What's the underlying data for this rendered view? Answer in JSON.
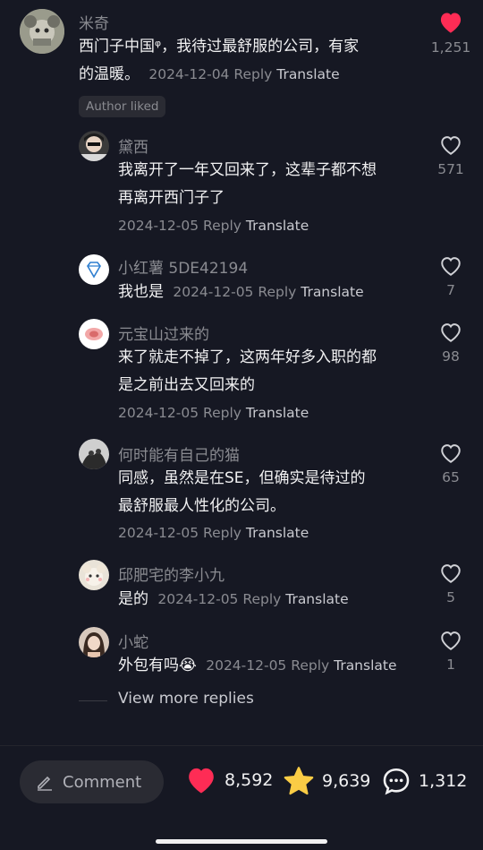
{
  "main_comment": {
    "username": "米奇",
    "text_line1": "西门子中国ᵠ，我待过最舒服的公司，有家",
    "text_line2": "的温暖。",
    "date": "2024-12-04",
    "reply": "Reply",
    "translate": "Translate",
    "likes": "1,251",
    "liked": true,
    "badge": "Author liked"
  },
  "replies": [
    {
      "username": "黛西",
      "line1": "我离开了一年又回来了，这辈子都不想",
      "line2": "再离开西门子了",
      "date": "2024-12-05",
      "likes": "571"
    },
    {
      "username": "小红薯 5DE42194",
      "line1": "我也是",
      "date": "2024-12-05",
      "likes": "7"
    },
    {
      "username": "元宝山过来的",
      "line1": "来了就走不掉了，这两年好多入职的都",
      "line2": "是之前出去又回来的",
      "date": "2024-12-05",
      "likes": "98"
    },
    {
      "username": "何时能有自己的猫",
      "line1": "同感，虽然是在SE，但确实是待过的",
      "line2": "最舒服最人性化的公司。",
      "date": "2024-12-05",
      "likes": "65"
    },
    {
      "username": "邱肥宅的李小九",
      "line1": "是的",
      "date": "2024-12-05",
      "likes": "5"
    },
    {
      "username": "小蛇",
      "line1": "外包有吗😭",
      "date": "2024-12-05",
      "likes": "1"
    }
  ],
  "labels": {
    "reply": "Reply",
    "translate": "Translate"
  },
  "view_more": "View more replies",
  "bottom_bar": {
    "comment_placeholder": "Comment",
    "likes": "8,592",
    "favorites": "9,639",
    "comments": "1,312"
  },
  "colors": {
    "background": "#161823",
    "like_red": "#fe2c55",
    "star_yellow": "#facc45"
  }
}
